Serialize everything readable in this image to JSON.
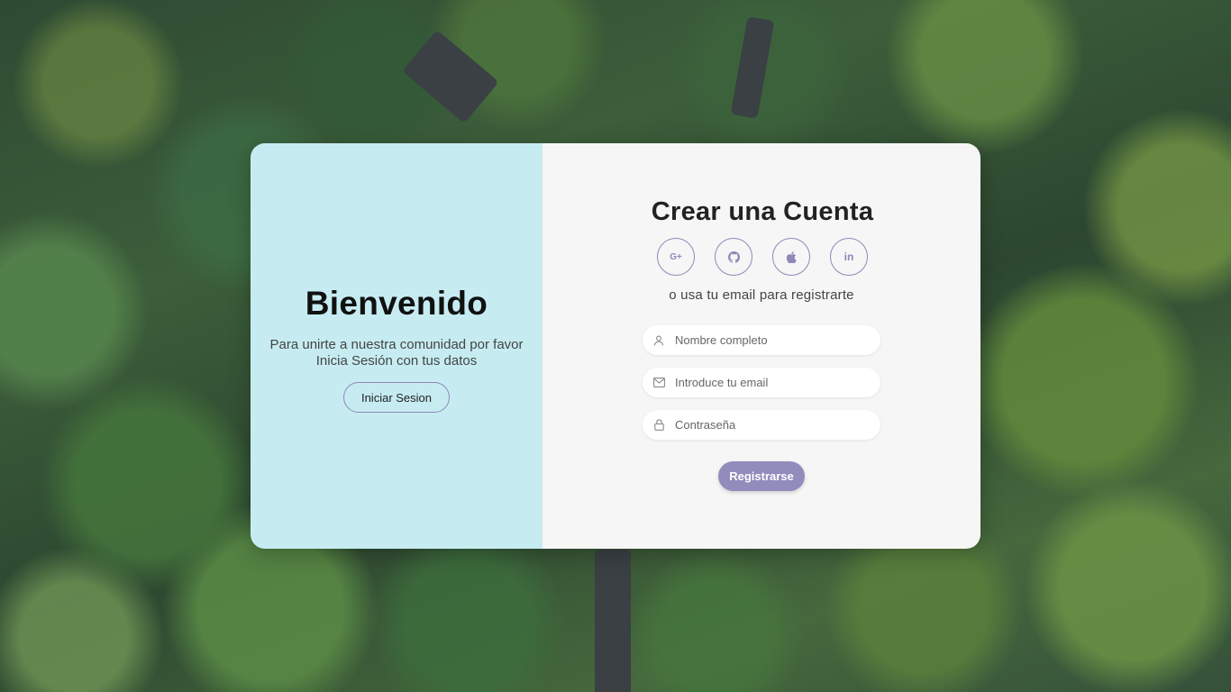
{
  "background": {
    "image": "forest-aerial-photo"
  },
  "welcome": {
    "title": "Bienvenido",
    "message": "Para unirte a nuestra comunidad por favor Inicia Sesión con tus datos",
    "login_button": "Iniciar Sesion"
  },
  "signup": {
    "title": "Crear una Cuenta",
    "socials": [
      {
        "icon": "google-plus-icon",
        "glyph": "G+"
      },
      {
        "icon": "github-icon",
        "glyph": ""
      },
      {
        "icon": "apple-icon",
        "glyph": ""
      },
      {
        "icon": "linkedin-icon",
        "glyph": "in"
      }
    ],
    "hint": "o usa tu email para registrarte",
    "name_placeholder": "Nombre completo",
    "email_placeholder": "Introduce tu email",
    "password_placeholder": "Contraseña",
    "submit_label": "Registrarse"
  },
  "colors": {
    "accent": "#928cbd",
    "left_panel": "#c6ecf2",
    "right_panel": "#f6f6f6"
  }
}
